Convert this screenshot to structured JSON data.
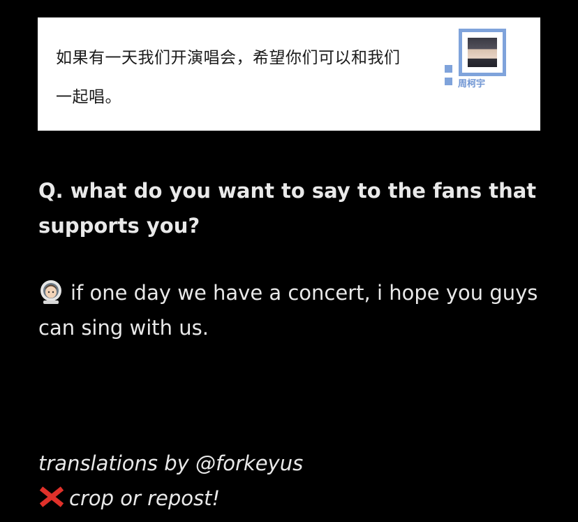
{
  "card": {
    "quote_line1": "如果有一天我们开演唱会，希望你们可以和我们",
    "quote_line2": "一起唱。",
    "badge_name": "周柯宇"
  },
  "question": "Q. what do you want to say to the fans that supports you?",
  "answer": {
    "emoji": "astronaut-emoji",
    "text": "if one day we have a concert, i hope you guys can sing with us."
  },
  "credit": {
    "line1": "translations by @forkeyus",
    "icon": "cross-mark-icon",
    "line2": "crop or repost!"
  },
  "colors": {
    "background": "#000000",
    "card": "#ffffff",
    "badge_accent": "#7fa3db",
    "cross": "#e0312a"
  }
}
